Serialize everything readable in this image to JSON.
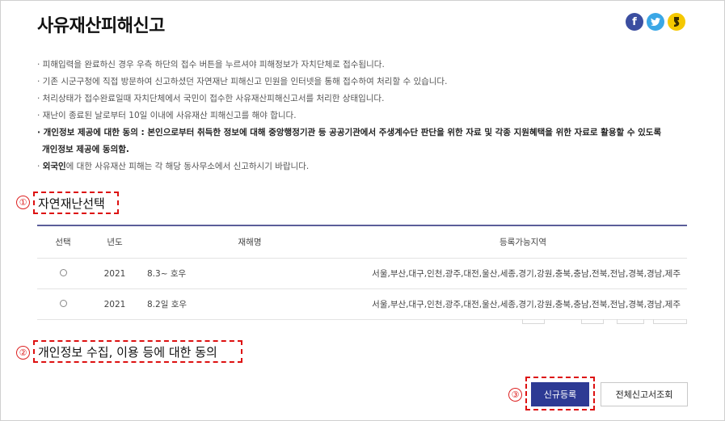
{
  "page": {
    "title": "사유재산피해신고"
  },
  "social": [
    "facebook-icon",
    "twitter-icon",
    "kakaostory-icon"
  ],
  "notices": {
    "n1": "· 피해입력을 완료하신 경우 우측 하단의 접수 버튼을 누르셔야 피해정보가 자치단체로 접수됩니다.",
    "n2": "· 기존 시군구청에 직접 방문하여 신고하셨던 자연재난 피해신고 민원을 인터넷을 통해 접수하여 처리할 수 있습니다.",
    "n3": "· 처리상태가 접수완료일때 자치단체에서 국민이 접수한 사유재산피해신고서를 처리한 상태입니다.",
    "n4": "· 재난이 종료된 날로부터 10일 이내에 사유재산 피해신고를 해야 합니다.",
    "n5a": "· 개인정보 제공에 대한 동의 : 본인으로부터 취득한 정보에 대해 중앙행정기관 등 공공기관에서 주생계수단 판단을 위한 자료 및 각종 지원혜택을 위한 자료로 활용할 수 있도록",
    "n5b": "개인정보 제공에 동의함.",
    "n6_prefix": "· ",
    "n6_bold": "외국인",
    "n6_rest": "에 대한 사유재산 피해는 각 해당 동사무소에서 신고하시기 바랍니다."
  },
  "steps": {
    "s1_marker": "①",
    "s1_title": "자연재난선택",
    "s2_marker": "②",
    "s2_title": "개인정보 수집, 이용 등에 대한 동의",
    "s3_marker": "③"
  },
  "table": {
    "headers": {
      "select": "선택",
      "year": "년도",
      "name": "재해명",
      "region": "등록가능지역"
    },
    "rows": [
      {
        "year": "2021",
        "name": "8.3~ 호우",
        "region": "서울,부산,대구,인천,광주,대전,울산,세종,경기,강원,충북,충남,전북,전남,경북,경남,제주"
      },
      {
        "year": "2021",
        "name": "8.2일 호우",
        "region": "서울,부산,대구,인천,광주,대전,울산,세종,경기,강원,충북,충남,전북,전남,경북,경남,제주"
      }
    ]
  },
  "buttons": {
    "new_register": "신규등록",
    "view_all": "전체신고서조회"
  },
  "colors": {
    "primary": "#2d3a94",
    "table_top_border": "#5b5e99",
    "annotation_red": "#d11111",
    "facebook": "#3b4ea0",
    "twitter": "#3aa7e6",
    "kakaostory": "#f5c800"
  }
}
